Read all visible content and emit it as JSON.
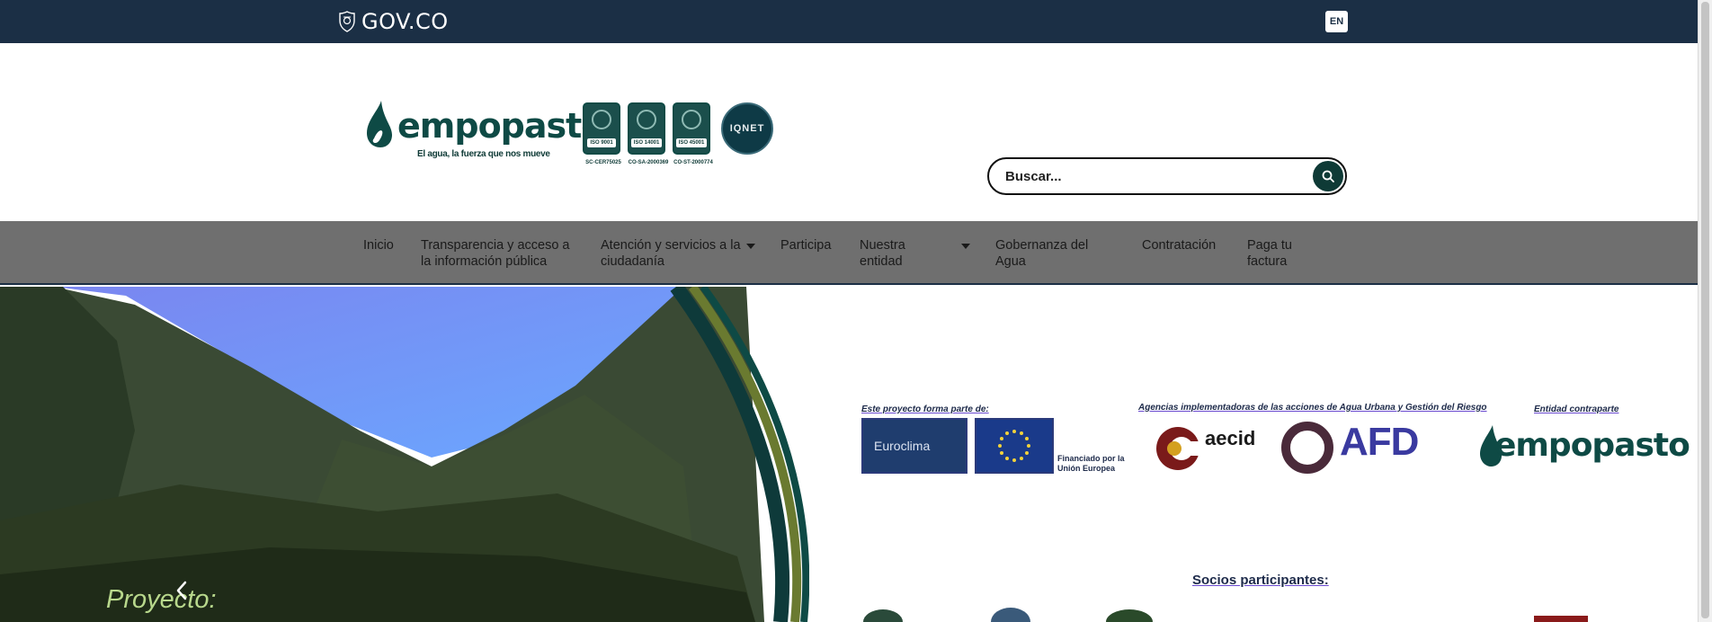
{
  "govbar": {
    "brand": "GOV.CO",
    "lang_button": "EN",
    "icon": "colombia-shield-icon"
  },
  "header": {
    "logo_text": "empopasto",
    "tagline": "El agua, la fuerza que nos mueve",
    "certifications": [
      {
        "label": "ISO 9001",
        "code": "SC-CER75025"
      },
      {
        "label": "ISO 14001",
        "code": "CO-SA-2000369"
      },
      {
        "label": "ISO 45001",
        "code": "CO-ST-2000774"
      }
    ],
    "iqnet_label": "IQNET",
    "search": {
      "placeholder": "Buscar...",
      "icon": "search-icon"
    }
  },
  "nav": {
    "items": [
      {
        "label": "Inicio",
        "dropdown": false
      },
      {
        "label": "Transparencia y acceso a la información pública",
        "dropdown": false
      },
      {
        "label": "Atención y servicios a la ciudadanía",
        "dropdown": true
      },
      {
        "label": "Participa",
        "dropdown": false
      },
      {
        "label": "Nuestra entidad",
        "dropdown": true
      },
      {
        "label": "Gobernanza del Agua",
        "dropdown": false
      },
      {
        "label": "Contratación",
        "dropdown": false
      },
      {
        "label": "Paga tu factura",
        "dropdown": false
      }
    ]
  },
  "hero": {
    "title": "Proyecto:",
    "prev_icon": "chevron-left-icon",
    "project_label": "Este proyecto forma parte de:",
    "agencies_label": "Agencias implementadoras de las acciones de Agua Urbana y Gestión del Riesgo",
    "partner_label": "Entidad contraparte",
    "funded_by": "Financiado por la Unión Europea",
    "euroclima": "Euroclima",
    "aecid": "aecid",
    "afd": "AFD",
    "empopasto": "empopasto",
    "partners_title": "Socios participantes:"
  },
  "colors": {
    "govbar": "#1b2f45",
    "brand_green": "#0e4a45",
    "nav_bg": "#6f6f6f"
  }
}
